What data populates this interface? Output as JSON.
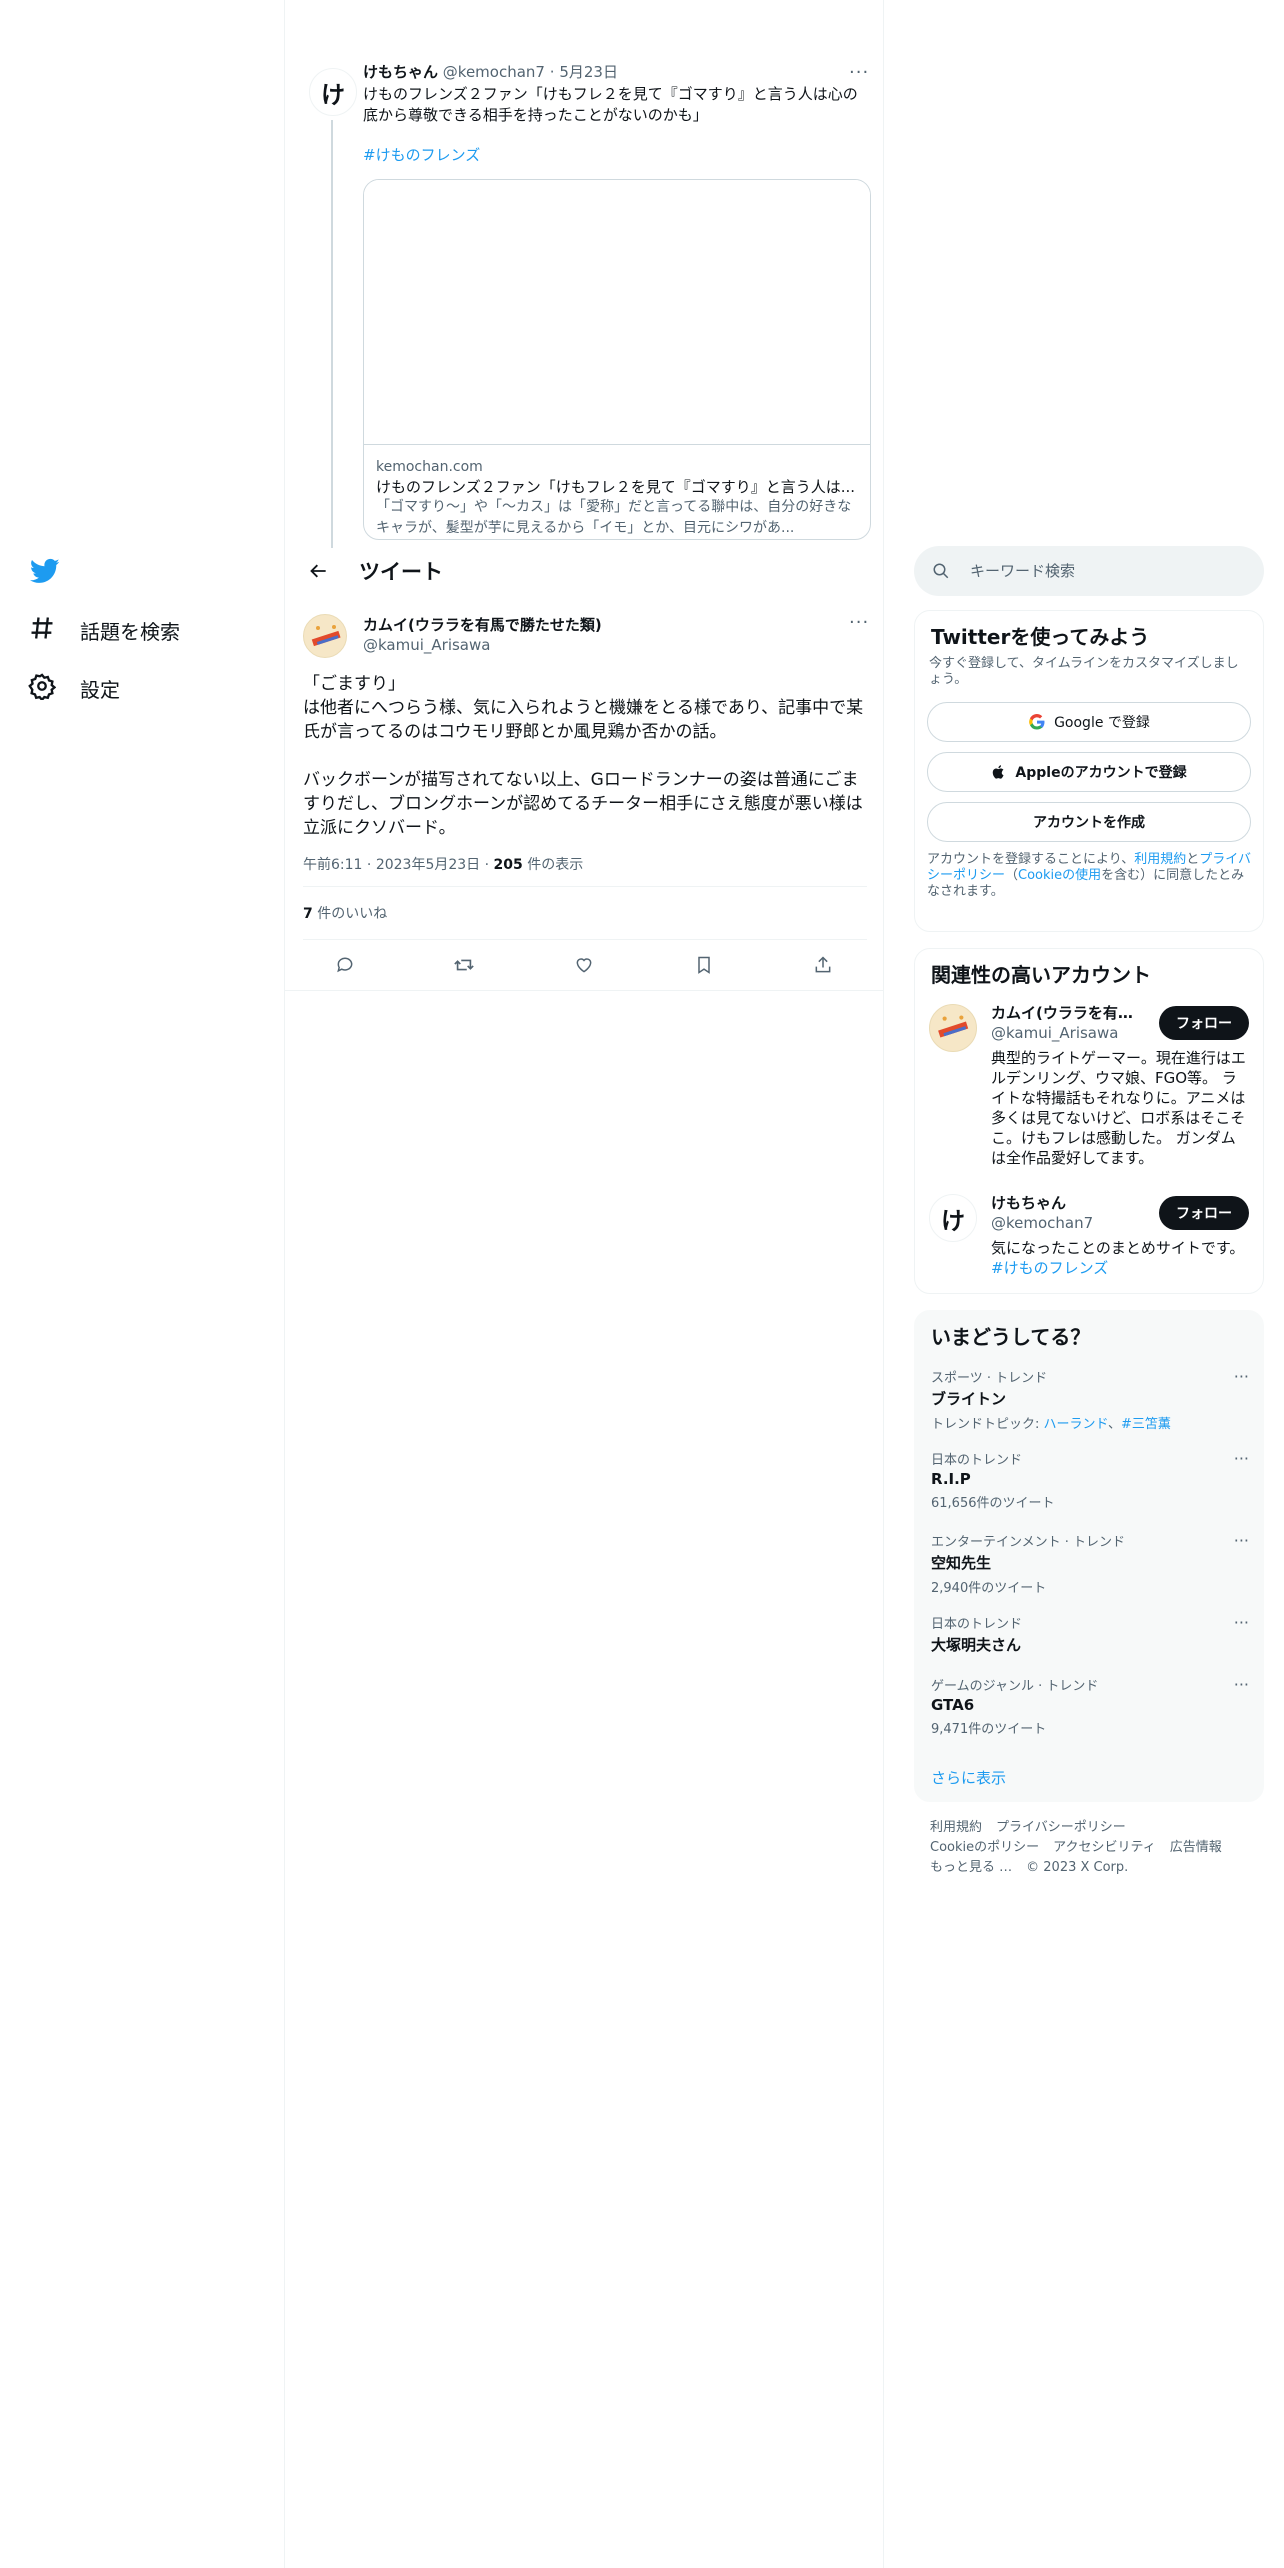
{
  "nav": {
    "logo": "twitter-bird",
    "items": [
      {
        "label": "話題を検索",
        "icon": "hashtag-icon"
      },
      {
        "label": "設定",
        "icon": "gear-icon"
      }
    ]
  },
  "parent_tweet": {
    "avatar_text": "け",
    "name": "けもちゃん",
    "handle": "@kemochan7",
    "sep": "·",
    "date": "5月23日",
    "text": "けものフレンズ２ファン「けもフレ２を見て『ゴマすり』と言う人は心の底から尊敬できる相手を持ったことがないのかも」",
    "hashtag": "#けものフレンズ",
    "card": {
      "domain": "kemochan.com",
      "title": "けものフレンズ２ファン「けもフレ２を見て『ゴマすり』と言う人は...",
      "desc": "「ゴマすり～」や「～カス」は「愛称」だと言ってる聯中は、自分の好きなキャラが、髪型が芋に見えるから「イモ」とか、目元にシワがあ..."
    }
  },
  "header": {
    "title": "ツイート"
  },
  "main_tweet": {
    "name": "カムイ(ウララを有馬で勝たせた類)",
    "handle": "@kamui_Arisawa",
    "text": "「ごますり」\nは他者にへつらう様、気に入られようと機嫌をとる様であり、記事中で某氏が言ってるのはコウモリ野郎とか風見鶏か否かの話。\n\nバックボーンが描写されてない以上、Gロードランナーの姿は普通にごますりだし、ブロングホーンが認めてるチーター相手にさえ態度が悪い様は立派にクソバード。",
    "time": "午前6:11",
    "date": "2023年5月23日",
    "views_count": "205",
    "views_label": "件の表示",
    "likes_count": "7",
    "likes_label": "件のいいね",
    "actions": [
      "reply-icon",
      "retweet-icon",
      "like-icon",
      "bookmark-icon",
      "share-icon"
    ]
  },
  "search": {
    "placeholder": "キーワード検索"
  },
  "signup": {
    "title": "Twitterを使ってみよう",
    "subtitle": "今すぐ登録して、タイムラインをカスタマイズしましょう。",
    "google_label": "Google で登録",
    "apple_label": "Appleのアカウントで登録",
    "create_label": "アカウントを作成",
    "terms_prefix": "アカウントを登録することにより、",
    "terms_link": "利用規約",
    "terms_and": "と",
    "privacy_link": "プライバシーポリシー",
    "paren_open": "（",
    "cookie_link": "Cookieの使用",
    "terms_suffix": "を含む）に同意したとみなされます。"
  },
  "related": {
    "title": "関連性の高いアカウント",
    "accounts": [
      {
        "name": "カムイ(ウララを有馬で勝たせた類)",
        "handle": "@kamui_Arisawa",
        "follow": "フォロー",
        "bio": "典型的ライトゲーマー。現在進行はエルデンリング、ウマ娘、FGO等。 ライトな特撮話もそれなりに。アニメは多くは見てないけど、ロボ系はそこそこ。けもフレは感動した。 ガンダムは全作品愛好してます。"
      },
      {
        "avatar_text": "け",
        "name": "けもちゃん",
        "handle": "@kemochan7",
        "follow": "フォロー",
        "bio": "気になったことのまとめサイトです。",
        "bio_link": "#けものフレンズ"
      }
    ]
  },
  "trends": {
    "title": "いまどうしてる？",
    "items": [
      {
        "context": "スポーツ · トレンド",
        "name": "ブライトン",
        "topics_label": "トレンドトピック: ",
        "topic1": "ハーランド",
        "topic_sep": "、",
        "topic2": "#三笘薫"
      },
      {
        "context": "日本のトレンド",
        "name": "R.I.P",
        "count": "61,656件のツイート"
      },
      {
        "context": "エンターテインメント · トレンド",
        "name": "空知先生",
        "count": "2,940件のツイート"
      },
      {
        "context": "日本のトレンド",
        "name": "大塚明夫さん"
      },
      {
        "context": "ゲームのジャンル · トレンド",
        "name": "GTA6",
        "count": "9,471件のツイート"
      }
    ],
    "show_more": "さらに表示"
  },
  "footer": {
    "links": [
      "利用規約",
      "プライバシーポリシー",
      "Cookieのポリシー",
      "アクセシビリティ",
      "広告情報",
      "もっと見る …"
    ],
    "copyright": "© 2023 X Corp."
  },
  "colors": {
    "accent": "#1d9bf0",
    "text": "#0f1419",
    "muted": "#536471",
    "border": "#eff3f4"
  }
}
